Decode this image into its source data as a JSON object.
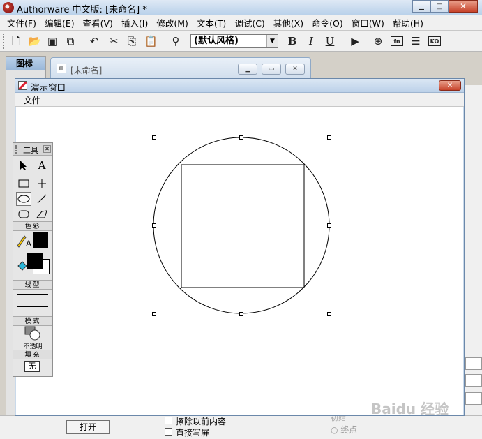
{
  "app": {
    "title": "Authorware 中文版: [未命名] *"
  },
  "menubar": {
    "items": [
      "文件(F)",
      "编辑(E)",
      "查看(V)",
      "插入(I)",
      "修改(M)",
      "文本(T)",
      "调试(C)",
      "其他(X)",
      "命令(O)",
      "窗口(W)",
      "帮助(H)"
    ]
  },
  "toolbar": {
    "style_value": "(默认风格)",
    "bold_label": "B",
    "italic_label": "I",
    "underline_label": "U",
    "fn_label": "fn",
    "ko_label": "KO"
  },
  "icons_panel": {
    "title": "图标"
  },
  "design_window": {
    "title": "[未命名]"
  },
  "presentation_window": {
    "title": "演示窗口",
    "menu_file": "文件"
  },
  "tools_panel": {
    "title": "工具",
    "text_tool_glyph": "A",
    "color_section": "色彩",
    "line_section": "线型",
    "mode_section": "模式",
    "mode_value": "不透明",
    "fill_section": "填充",
    "fill_value": "无"
  },
  "bottom": {
    "open_button": "打开",
    "erase_checkbox": "擦除以前内容",
    "direct_checkbox": "直接写屏",
    "radio_end": "终点",
    "radio_start": "初始"
  },
  "watermark": "Baidu 经验",
  "colors": {
    "accent_close": "#c7432b",
    "titlebar": "#b9d1ea"
  }
}
